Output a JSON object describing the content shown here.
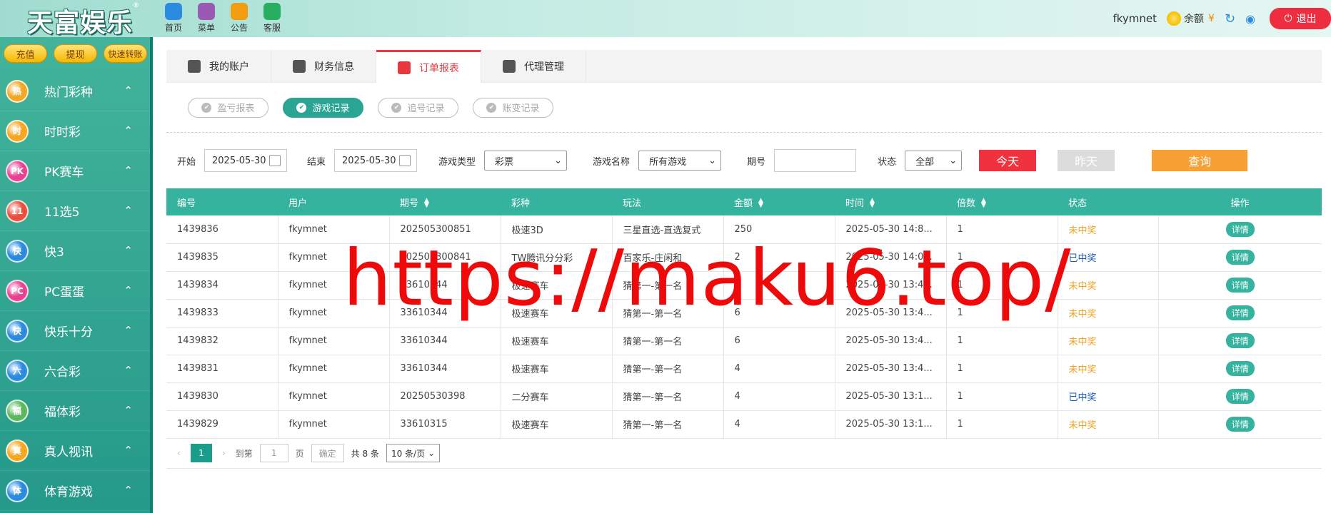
{
  "brand": {
    "logo_text": "天富娱乐",
    "logo_mark": "®"
  },
  "topnav": [
    {
      "label": "首页",
      "icon": "home-icon"
    },
    {
      "label": "菜单",
      "icon": "grid-icon"
    },
    {
      "label": "公告",
      "icon": "megaphone-icon"
    },
    {
      "label": "客服",
      "icon": "chat-icon"
    }
  ],
  "user": {
    "name": "fkymnet",
    "balance_label": "余额",
    "currency": "¥",
    "logout": "退出"
  },
  "side_buttons": [
    "充值",
    "提现",
    "快速转账"
  ],
  "menu": [
    {
      "label": "热门彩种",
      "badge": "热",
      "color": "#f5a623"
    },
    {
      "label": "时时彩",
      "badge": "时",
      "color": "#f5a623"
    },
    {
      "label": "PK赛车",
      "badge": "PK",
      "color": "#e84393"
    },
    {
      "label": "11选5",
      "badge": "11",
      "color": "#e8503d"
    },
    {
      "label": "快3",
      "badge": "快",
      "color": "#2a8be0"
    },
    {
      "label": "PC蛋蛋",
      "badge": "PC",
      "color": "#e84393"
    },
    {
      "label": "快乐十分",
      "badge": "快",
      "color": "#2a8be0"
    },
    {
      "label": "六合彩",
      "badge": "六",
      "color": "#2a8be0"
    },
    {
      "label": "福体彩",
      "badge": "福",
      "color": "#5cb85c"
    },
    {
      "label": "真人视讯",
      "badge": "真",
      "color": "#f5a623"
    },
    {
      "label": "体育游戏",
      "badge": "体",
      "color": "#2a8be0"
    }
  ],
  "tabs": [
    {
      "label": "我的账户",
      "active": false
    },
    {
      "label": "财务信息",
      "active": false
    },
    {
      "label": "订单报表",
      "active": true
    },
    {
      "label": "代理管理",
      "active": false
    }
  ],
  "subtabs": [
    {
      "label": "盈亏报表",
      "active": false
    },
    {
      "label": "游戏记录",
      "active": true
    },
    {
      "label": "追号记录",
      "active": false
    },
    {
      "label": "账变记录",
      "active": false
    }
  ],
  "filters": {
    "start_label": "开始",
    "start_value": "2025-05-30",
    "end_label": "结束",
    "end_value": "2025-05-30",
    "game_type_label": "游戏类型",
    "game_type_value": "彩票",
    "game_name_label": "游戏名称",
    "game_name_value": "所有游戏",
    "issue_label": "期号",
    "issue_value": "",
    "status_label": "状态",
    "status_value": "全部",
    "today": "今天",
    "yesterday": "昨天",
    "query": "查询"
  },
  "table": {
    "headers": [
      "编号",
      "用户",
      "期号",
      "彩种",
      "玩法",
      "金额",
      "时间",
      "倍数",
      "状态",
      "操作"
    ],
    "sortable": [
      false,
      false,
      true,
      false,
      false,
      true,
      true,
      true,
      false,
      false
    ],
    "rows": [
      [
        "1439836",
        "fkymnet",
        "202505300851",
        "极速3D",
        "三星直选-直选复式",
        "250",
        "2025-05-30 14:8...",
        "1",
        "未中奖",
        "详情"
      ],
      [
        "1439835",
        "fkymnet",
        "202505300841",
        "TW腾讯分分彩",
        "百家乐-庄闲和",
        "2",
        "2025-05-30 14:0...",
        "1",
        "已中奖",
        "详情"
      ],
      [
        "1439834",
        "fkymnet",
        "33610344",
        "极速赛车",
        "猜第一-第一名",
        "4",
        "2025-05-30 13:4...",
        "1",
        "未中奖",
        "详情"
      ],
      [
        "1439833",
        "fkymnet",
        "33610344",
        "极速赛车",
        "猜第一-第一名",
        "6",
        "2025-05-30 13:4...",
        "1",
        "未中奖",
        "详情"
      ],
      [
        "1439832",
        "fkymnet",
        "33610344",
        "极速赛车",
        "猜第一-第一名",
        "6",
        "2025-05-30 13:4...",
        "1",
        "未中奖",
        "详情"
      ],
      [
        "1439831",
        "fkymnet",
        "33610344",
        "极速赛车",
        "猜第一-第一名",
        "4",
        "2025-05-30 13:4...",
        "1",
        "未中奖",
        "详情"
      ],
      [
        "1439830",
        "fkymnet",
        "20250530398",
        "二分赛车",
        "猜第一-第一名",
        "4",
        "2025-05-30 13:1...",
        "1",
        "已中奖",
        "详情"
      ],
      [
        "1439829",
        "fkymnet",
        "33610315",
        "极速赛车",
        "猜第一-第一名",
        "4",
        "2025-05-30 13:1...",
        "1",
        "未中奖",
        "详情"
      ]
    ]
  },
  "pager": {
    "current": "1",
    "goto_label": "到第",
    "goto_value": "1",
    "page_label": "页",
    "confirm": "确定",
    "total": "共 8 条",
    "page_size": "10 条/页"
  },
  "watermark": "https://maku6.top/"
}
